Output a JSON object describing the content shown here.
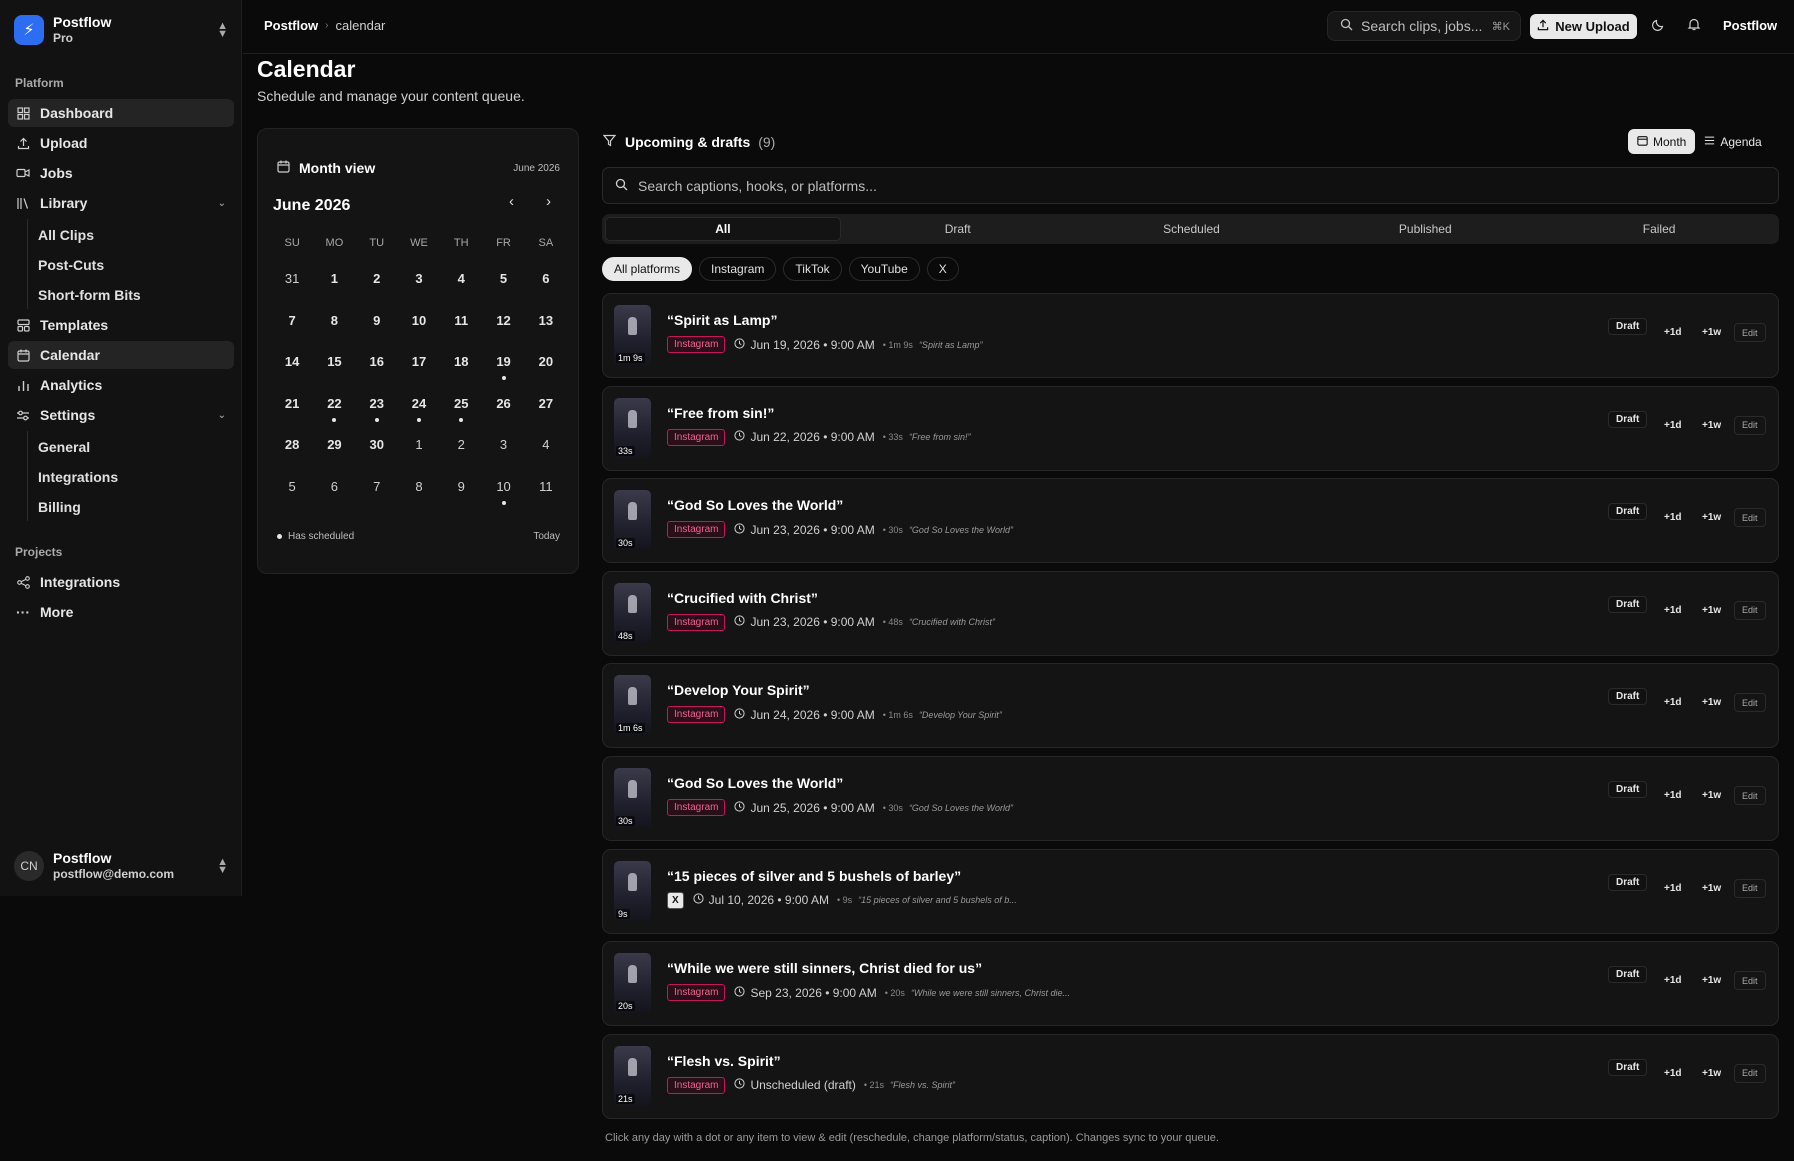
{
  "brand": {
    "name": "Postflow",
    "plan": "Pro"
  },
  "sidebar": {
    "section_platform": "Platform",
    "items": [
      {
        "label": "Dashboard",
        "icon": "grid-icon"
      },
      {
        "label": "Upload",
        "icon": "upload-icon"
      },
      {
        "label": "Jobs",
        "icon": "video-icon"
      },
      {
        "label": "Library",
        "icon": "library-icon"
      },
      {
        "label": "Templates",
        "icon": "templates-icon"
      },
      {
        "label": "Calendar",
        "icon": "calendar-icon"
      },
      {
        "label": "Analytics",
        "icon": "chart-icon"
      },
      {
        "label": "Settings",
        "icon": "settings-icon"
      }
    ],
    "library_sub": [
      "All Clips",
      "Post-Cuts",
      "Short-form Bits"
    ],
    "settings_sub": [
      "General",
      "Integrations",
      "Billing"
    ],
    "section_projects": "Projects",
    "projects": [
      {
        "label": "Integrations",
        "icon": "share-icon"
      },
      {
        "label": "More",
        "icon": "more-icon"
      }
    ],
    "user": {
      "initials": "CN",
      "name": "Postflow",
      "email": "postflow@demo.com"
    }
  },
  "topbar": {
    "crumb_root": "Postflow",
    "crumb_sep": "›",
    "crumb_page": "calendar",
    "search_placeholder": "Search clips, jobs...",
    "search_kbd": "⌘K",
    "upload_label": "New Upload",
    "user_label": "Postflow"
  },
  "header": {
    "title": "Calendar",
    "subtitle": "Schedule and manage your content queue."
  },
  "month_card": {
    "title": "Month view",
    "date_label": "June 2026",
    "month": "June 2026",
    "dow": [
      "SU",
      "MO",
      "TU",
      "WE",
      "TH",
      "FR",
      "SA"
    ],
    "weeks": [
      [
        {
          "d": "31",
          "m": true
        },
        {
          "d": "1"
        },
        {
          "d": "2"
        },
        {
          "d": "3"
        },
        {
          "d": "4"
        },
        {
          "d": "5"
        },
        {
          "d": "6"
        }
      ],
      [
        {
          "d": "7"
        },
        {
          "d": "8"
        },
        {
          "d": "9"
        },
        {
          "d": "10"
        },
        {
          "d": "11"
        },
        {
          "d": "12"
        },
        {
          "d": "13"
        }
      ],
      [
        {
          "d": "14"
        },
        {
          "d": "15"
        },
        {
          "d": "16"
        },
        {
          "d": "17"
        },
        {
          "d": "18"
        },
        {
          "d": "19",
          "dot": true
        },
        {
          "d": "20"
        }
      ],
      [
        {
          "d": "21"
        },
        {
          "d": "22",
          "dot": true
        },
        {
          "d": "23",
          "dot": true
        },
        {
          "d": "24",
          "dot": true
        },
        {
          "d": "25",
          "dot": true
        },
        {
          "d": "26"
        },
        {
          "d": "27"
        }
      ],
      [
        {
          "d": "28"
        },
        {
          "d": "29"
        },
        {
          "d": "30"
        },
        {
          "d": "1",
          "m": true
        },
        {
          "d": "2",
          "m": true
        },
        {
          "d": "3",
          "m": true
        },
        {
          "d": "4",
          "m": true
        }
      ],
      [
        {
          "d": "5",
          "m": true
        },
        {
          "d": "6",
          "m": true
        },
        {
          "d": "7",
          "m": true
        },
        {
          "d": "8",
          "m": true
        },
        {
          "d": "9",
          "m": true
        },
        {
          "d": "10",
          "m": true,
          "dot": true
        },
        {
          "d": "11",
          "m": true
        }
      ]
    ],
    "legend": "Has scheduled",
    "today": "Today"
  },
  "list": {
    "title": "Upcoming & drafts",
    "count": "(9)",
    "view_month": "Month",
    "view_agenda": "Agenda",
    "search_placeholder": "Search captions, hooks, or platforms...",
    "tabs": [
      "All",
      "Draft",
      "Scheduled",
      "Published",
      "Failed"
    ],
    "platforms": [
      "All platforms",
      "Instagram",
      "TikTok",
      "YouTube",
      "X"
    ],
    "items": [
      {
        "title": "“Spirit as Lamp”",
        "platform": "Instagram",
        "when": "Jun 19, 2026 • 9:00 AM",
        "len": "• 1m 9s",
        "hook": "“Spirit as Lamp”",
        "dur": "1m 9s",
        "status": "Draft"
      },
      {
        "title": "“Free from sin!”",
        "platform": "Instagram",
        "when": "Jun 22, 2026 • 9:00 AM",
        "len": "• 33s",
        "hook": "“Free from sin!”",
        "dur": "33s",
        "status": "Draft"
      },
      {
        "title": "“God So Loves the World”",
        "platform": "Instagram",
        "when": "Jun 23, 2026 • 9:00 AM",
        "len": "• 30s",
        "hook": "“God So Loves the World”",
        "dur": "30s",
        "status": "Draft"
      },
      {
        "title": "“Crucified with Christ”",
        "platform": "Instagram",
        "when": "Jun 23, 2026 • 9:00 AM",
        "len": "• 48s",
        "hook": "“Crucified with Christ”",
        "dur": "48s",
        "status": "Draft"
      },
      {
        "title": "“Develop Your Spirit”",
        "platform": "Instagram",
        "when": "Jun 24, 2026 • 9:00 AM",
        "len": "• 1m 6s",
        "hook": "“Develop Your Spirit”",
        "dur": "1m 6s",
        "status": "Draft"
      },
      {
        "title": "“God So Loves the World”",
        "platform": "Instagram",
        "when": "Jun 25, 2026 • 9:00 AM",
        "len": "• 30s",
        "hook": "“God So Loves the World”",
        "dur": "30s",
        "status": "Draft"
      },
      {
        "title": "“15 pieces of silver and 5 bushels of barley”",
        "platform": "X",
        "when": "Jul 10, 2026 • 9:00 AM",
        "len": "• 9s",
        "hook": "“15 pieces of silver and 5 bushels of b...",
        "dur": "9s",
        "status": "Draft"
      },
      {
        "title": "“While we were still sinners, Christ died for us”",
        "platform": "Instagram",
        "when": "Sep 23, 2026 • 9:00 AM",
        "len": "• 20s",
        "hook": "“While we were still sinners, Christ die...",
        "dur": "20s",
        "status": "Draft"
      },
      {
        "title": "“Flesh vs. Spirit”",
        "platform": "Instagram",
        "when": "Unscheduled (draft)",
        "len": "• 21s",
        "hook": "“Flesh vs. Spirit”",
        "dur": "21s",
        "status": "Draft"
      }
    ],
    "action_day": "+1d",
    "action_week": "+1w",
    "action_edit": "Edit",
    "footnote": "Click any day with a dot or any item to view & edit (reschedule, change platform/status, caption). Changes sync to your queue."
  },
  "colors": {
    "accent": "#2c6df2",
    "instagram": "#f06292"
  }
}
